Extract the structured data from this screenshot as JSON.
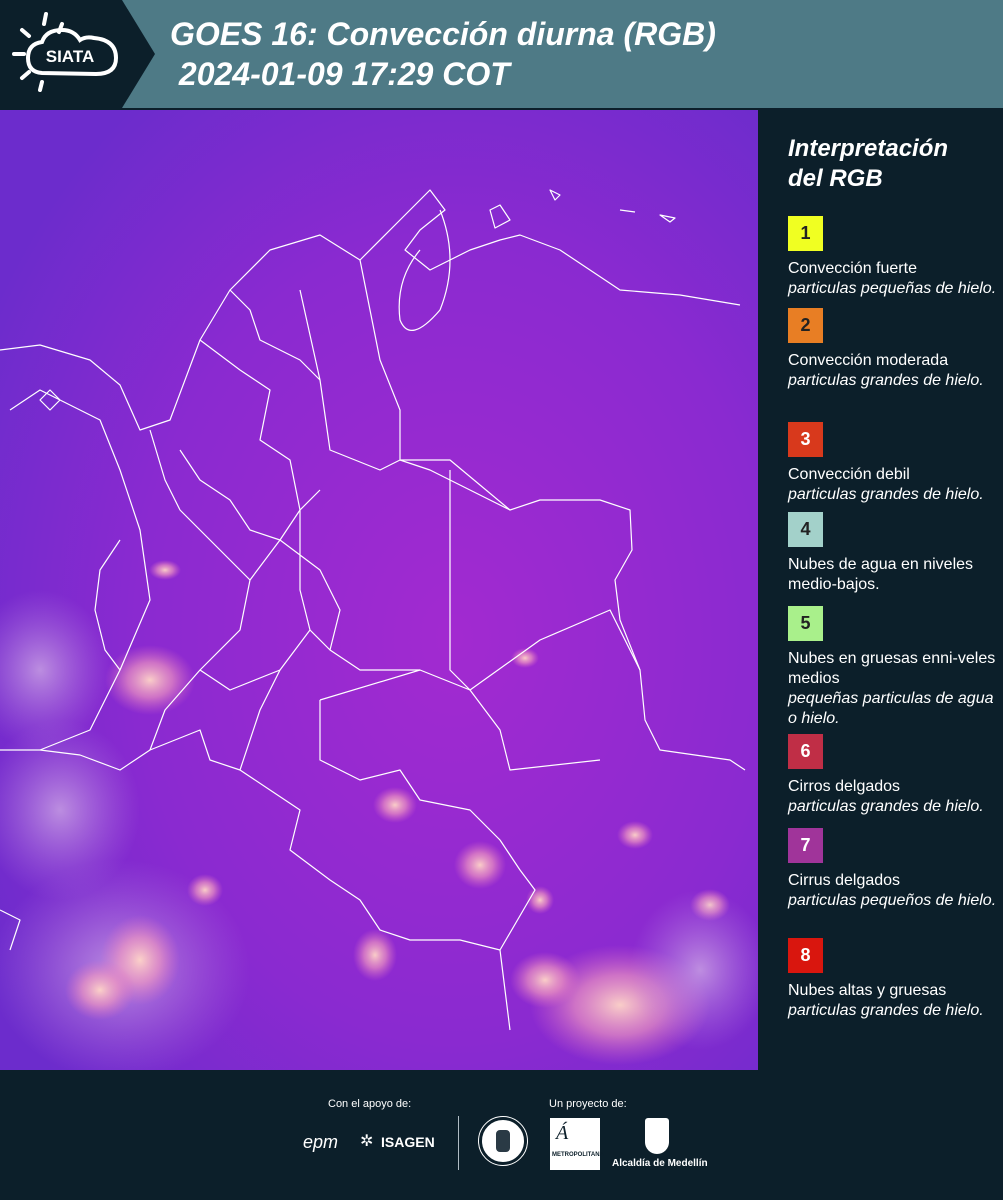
{
  "header": {
    "logo_text": "SIATA",
    "title": "GOES 16: Convección diurna (RGB)\n 2024-01-09 17:29 COT"
  },
  "map": {
    "background_color": "#7a28d0",
    "border_color": "#ffffff"
  },
  "legend": {
    "title": "Interpretación del RGB",
    "items": [
      {
        "num": "1",
        "color": "#f0ff22",
        "title": "Convección fuerte",
        "subtitle": "particulas pequeñas de hielo."
      },
      {
        "num": "2",
        "color": "#e87e24",
        "title": "Convección moderada",
        "subtitle": "particulas grandes de hielo."
      },
      {
        "num": "3",
        "color": "#d8391c",
        "title": "Convección debil",
        "subtitle": "particulas grandes de hielo."
      },
      {
        "num": "4",
        "color": "#a3d1ca",
        "title": "Nubes de agua en niveles medio-bajos.",
        "subtitle": ""
      },
      {
        "num": "5",
        "color": "#a9f08b",
        "title": "Nubes en gruesas enni-veles medios",
        "subtitle": "pequeñas particulas de agua o hielo."
      },
      {
        "num": "6",
        "color": "#c02e46",
        "title": "Cirros delgados",
        "subtitle": "particulas grandes de hielo."
      },
      {
        "num": "7",
        "color": "#a0349a",
        "title": "Cirrus delgados",
        "subtitle": "particulas pequeños de hielo."
      },
      {
        "num": "8",
        "color": "#d9160e",
        "title": "Nubes altas y gruesas",
        "subtitle": "particulas grandes de hielo."
      }
    ]
  },
  "footer": {
    "support_label": "Con el apoyo de:",
    "project_label": "Un proyecto de:",
    "sponsor1": "epm",
    "sponsor2": "ISAGEN",
    "partner_metro": "METROPOLITANA",
    "partner_alcaldia": "Alcaldía de Medellín"
  }
}
